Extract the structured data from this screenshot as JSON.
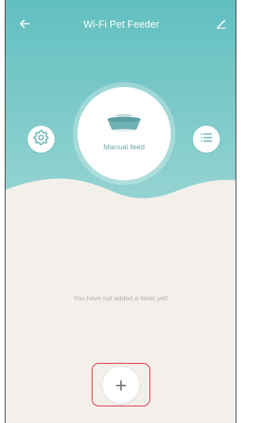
{
  "header": {
    "title": "Wi-Fi Pet Feeder",
    "back_icon": "arrow-left-icon",
    "edit_icon": "pencil-icon"
  },
  "feed": {
    "label": "Manual feed",
    "icon": "pet-bowl-icon"
  },
  "actions": {
    "settings_icon": "gear-icon",
    "list_icon": "list-icon"
  },
  "timers": {
    "empty_message": "You have not added a timer yet!"
  },
  "add_button": {
    "symbol": "+"
  },
  "colors": {
    "header_teal_top": "#62bfc0",
    "header_teal_bottom": "#8fd1d0",
    "background": "#f3f0ec",
    "accent_text": "#72a8aa",
    "highlight_red": "#d8283a"
  }
}
